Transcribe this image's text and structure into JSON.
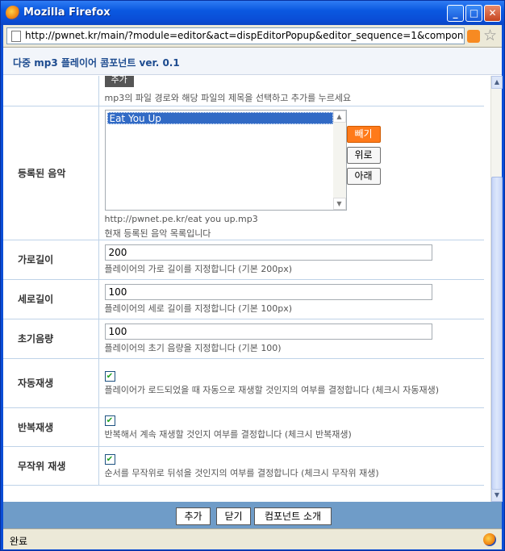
{
  "window": {
    "title": "Mozilla Firefox"
  },
  "address": {
    "url": "http://pwnet.kr/main/?module=editor&act=dispEditorPopup&editor_sequence=1&component=p"
  },
  "popup": {
    "title": "다중 mp3 플레이어 콤포넌트 ver. 0.1"
  },
  "form": {
    "add_row": {
      "button_label": "추가",
      "desc": "mp3의 파일 경로와 해당 파일의 제목을 선택하고 추가를 누르세요"
    },
    "registered": {
      "label": "등록된 음악",
      "items": [
        "Eat You Up"
      ],
      "selected_path": "http://pwnet.pe.kr/eat you up.mp3",
      "desc": "현재 등록된 음악 목록입니다",
      "remove_label": "빼기",
      "up_label": "위로",
      "down_label": "아래"
    },
    "width": {
      "label": "가로길이",
      "value": "200",
      "desc": "플레이어의 가로 길이를 지정합니다 (기본 200px)"
    },
    "height": {
      "label": "세로길이",
      "value": "100",
      "desc": "플레이어의 세로 길이를 지정합니다 (기본 100px)"
    },
    "volume": {
      "label": "초기음량",
      "value": "100",
      "desc": "플레이어의 초기 음량을 지정합니다 (기본 100)"
    },
    "autoplay": {
      "label": "자동재생",
      "checked": true,
      "desc": "플레이어가 로드되었을 때 자동으로 재생할 것인지의 여부를 결정합니다 (체크시 자동재생)"
    },
    "repeat": {
      "label": "반복재생",
      "checked": true,
      "desc": "반복해서 계속 재생할 것인지 여부를 결정합니다 (체크시 반복재생)"
    },
    "shuffle": {
      "label": "무작위 재생",
      "checked": true,
      "desc": "순서를 무작위로 뒤섞을 것인지의 여부를 결정합니다 (체크시 무작위 재생)"
    }
  },
  "footer": {
    "add_label": "추가",
    "close_label": "닫기",
    "intro_label": "컴포넌트 소개"
  },
  "status": {
    "text": "완료"
  },
  "colors": {
    "accent_orange": "#ff7a1a",
    "footer_bar": "#6f9cc8",
    "title_blue": "#0a4dd6"
  }
}
